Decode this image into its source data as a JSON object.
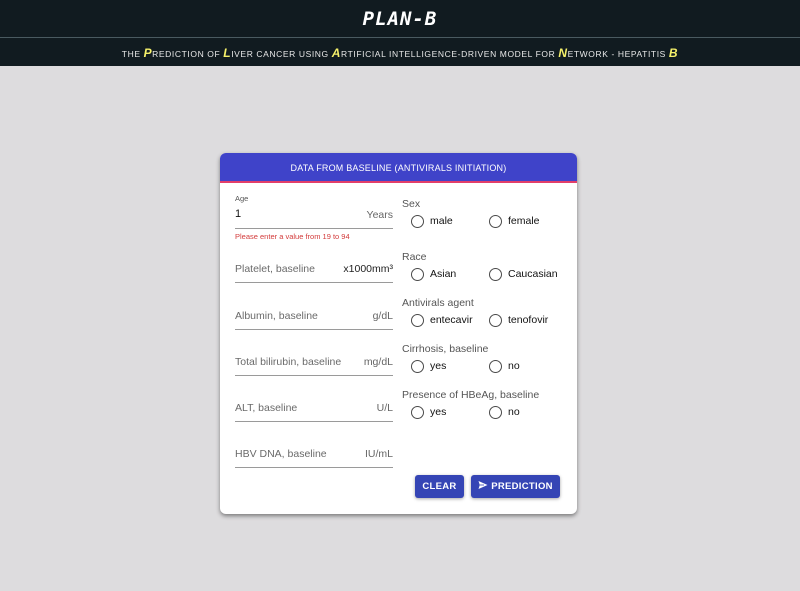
{
  "header": {
    "brand": "PLAN-B",
    "subtitle": [
      {
        "t": "THE ",
        "hl": false
      },
      {
        "t": "P",
        "hl": true
      },
      {
        "t": "REDICTION OF ",
        "hl": false
      },
      {
        "t": "L",
        "hl": true
      },
      {
        "t": "IVER CANCER USING  ",
        "hl": false
      },
      {
        "t": "A",
        "hl": true
      },
      {
        "t": "RTIFICIAL INTELLIGENCE-DRIVEN MODEL FOR ",
        "hl": false
      },
      {
        "t": "N",
        "hl": true
      },
      {
        "t": "ETWORK - HEPATITIS ",
        "hl": false
      },
      {
        "t": "B",
        "hl": true
      }
    ]
  },
  "form": {
    "title": "DATA FROM BASELINE (ANTIVIRALS INITIATION)",
    "age": {
      "label": "Age",
      "value": "1",
      "unit": "Years",
      "error": "Please enter a value from 19 to 94"
    },
    "fields": [
      {
        "label": "Platelet, baseline",
        "unit": "x1000mm³"
      },
      {
        "label": "Albumin, baseline",
        "unit": "g/dL"
      },
      {
        "label": "Total bilirubin, baseline",
        "unit": "mg/dL"
      },
      {
        "label": "ALT, baseline",
        "unit": "U/L"
      },
      {
        "label": "HBV DNA, baseline",
        "unit": "IU/mL"
      }
    ],
    "groups": [
      {
        "title": "Sex",
        "options": [
          "male",
          "female"
        ]
      },
      {
        "title": "Race",
        "options": [
          "Asian",
          "Caucasian"
        ]
      },
      {
        "title": "Antivirals agent",
        "options": [
          "entecavir",
          "tenofovir"
        ]
      },
      {
        "title": "Cirrhosis, baseline",
        "options": [
          "yes",
          "no"
        ]
      },
      {
        "title": "Presence of HBeAg, baseline",
        "options": [
          "yes",
          "no"
        ]
      }
    ],
    "buttons": {
      "clear": "CLEAR",
      "predict": "PREDICTION"
    }
  }
}
